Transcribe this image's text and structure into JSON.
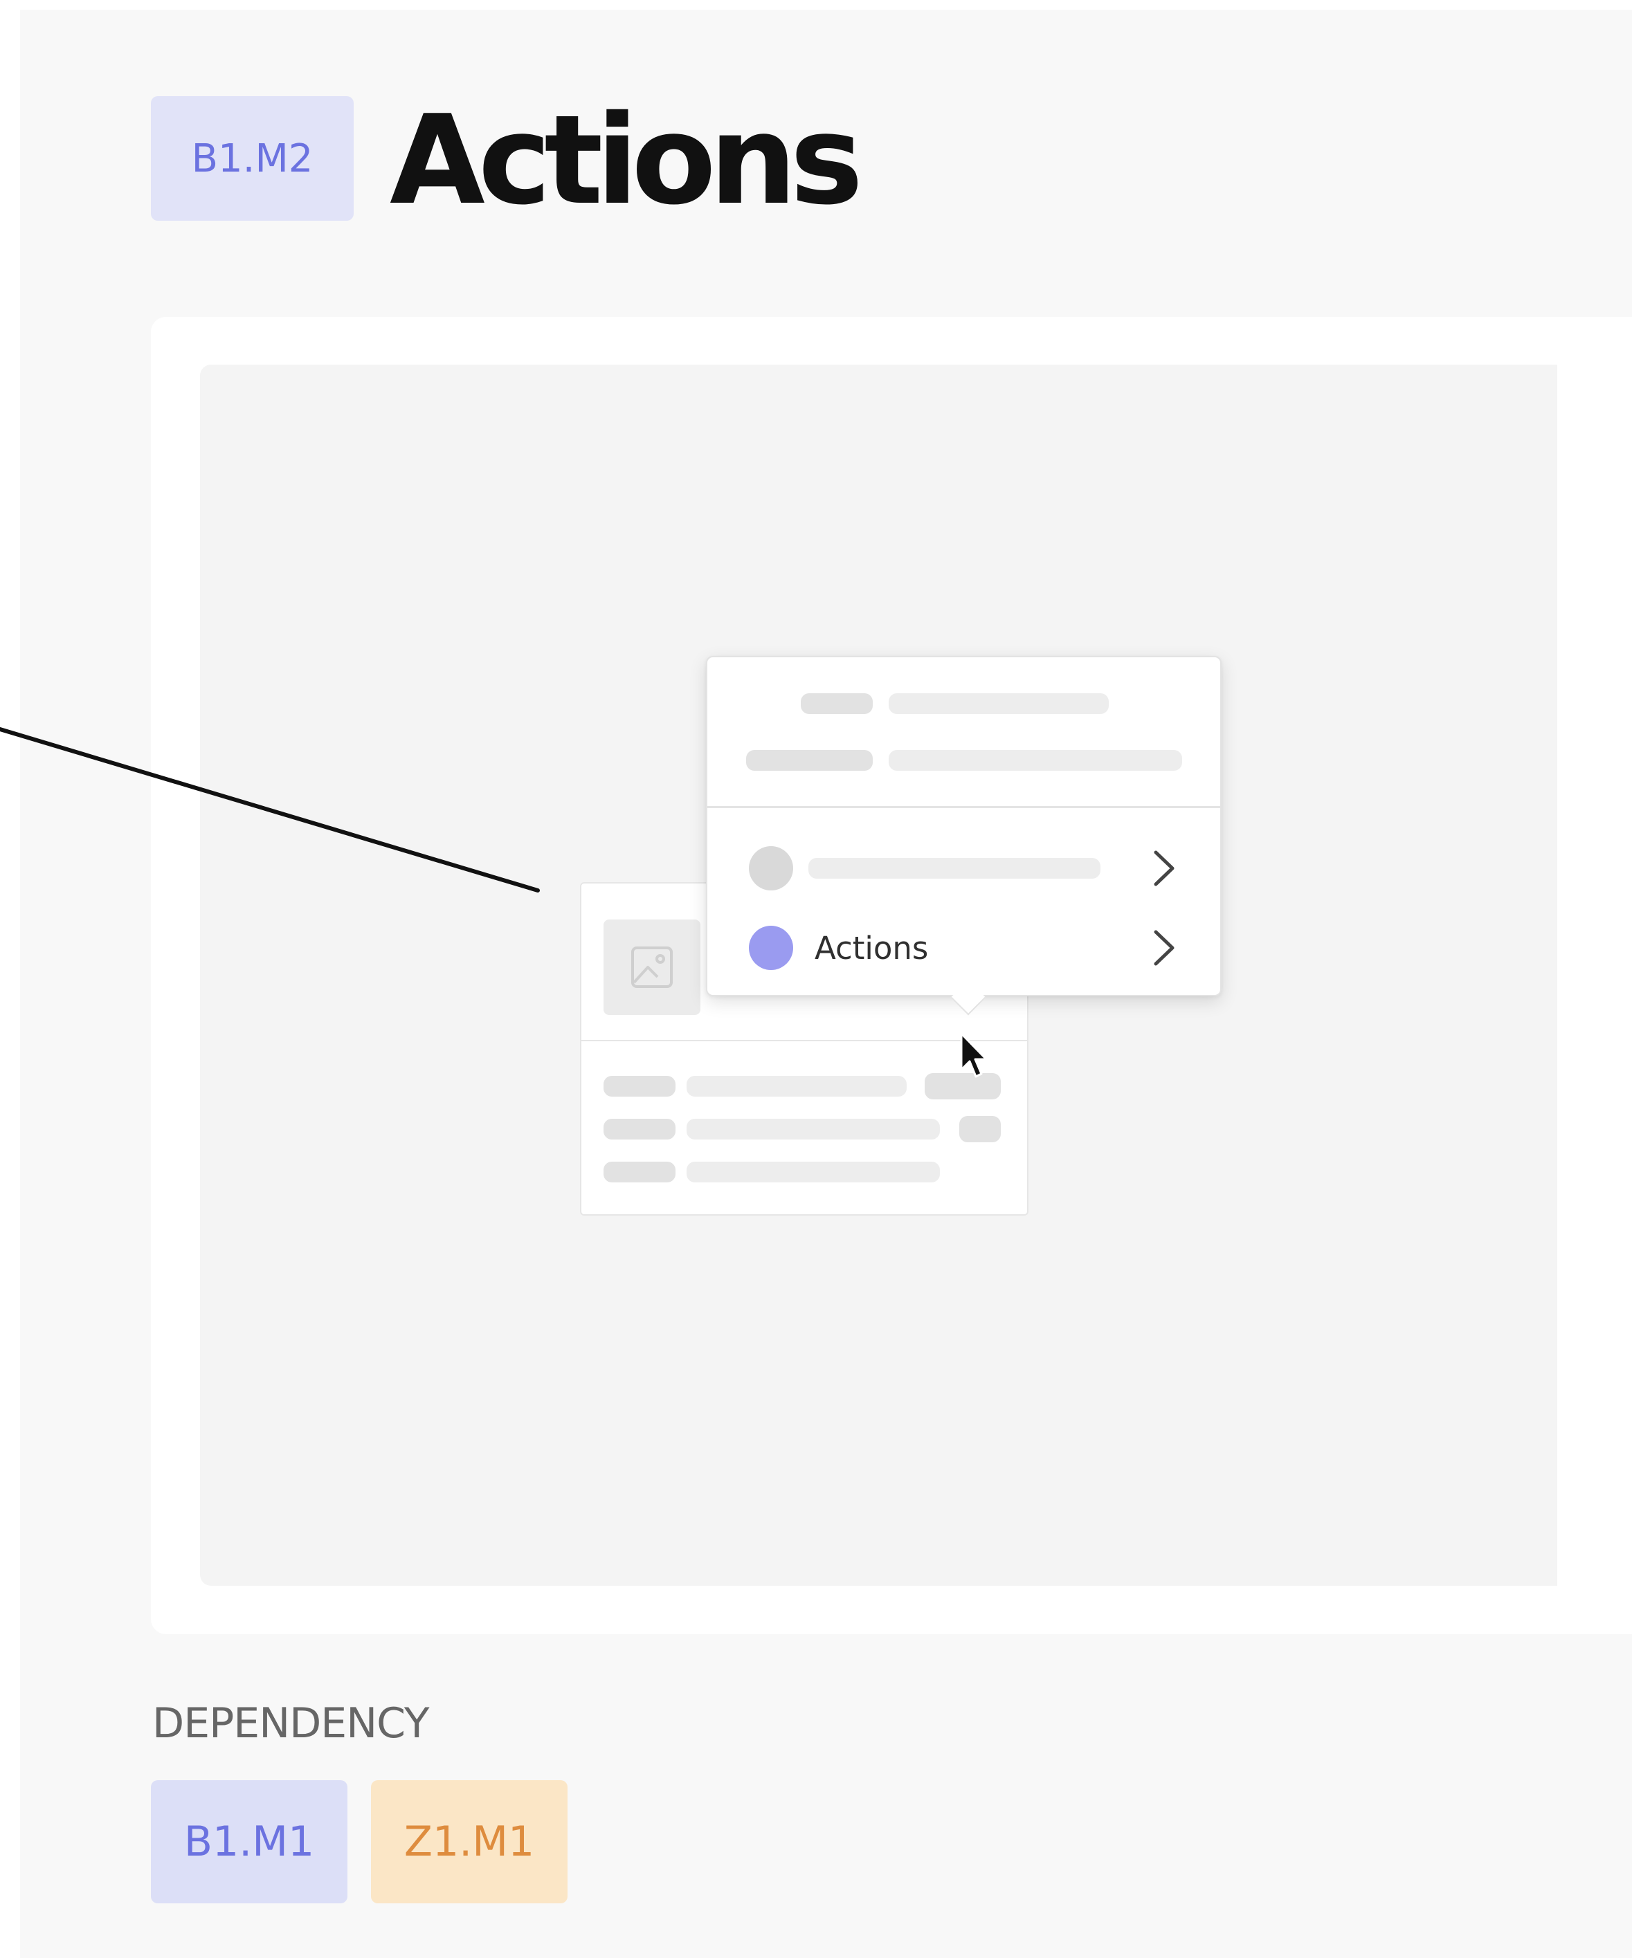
{
  "header": {
    "badge": "B1.M2",
    "title": "Actions"
  },
  "illustration": {
    "menu": {
      "items": [
        {
          "label": "",
          "dot_color": "#d9d9d9"
        },
        {
          "label": "Actions",
          "dot_color": "#9a9bf0"
        }
      ]
    }
  },
  "dependency": {
    "label": "DEPENDENCY",
    "badges": [
      {
        "label": "B1.M1",
        "bg": "#dcdff7",
        "color": "#6b72e0"
      },
      {
        "label": "Z1.M1",
        "bg": "#fbe6c6",
        "color": "#de8c3e"
      }
    ]
  },
  "colors": {
    "accent": "#6b72e0",
    "accent_light": "#e1e3f8",
    "orange": "#de8c3e",
    "orange_light": "#fbe6c6"
  }
}
